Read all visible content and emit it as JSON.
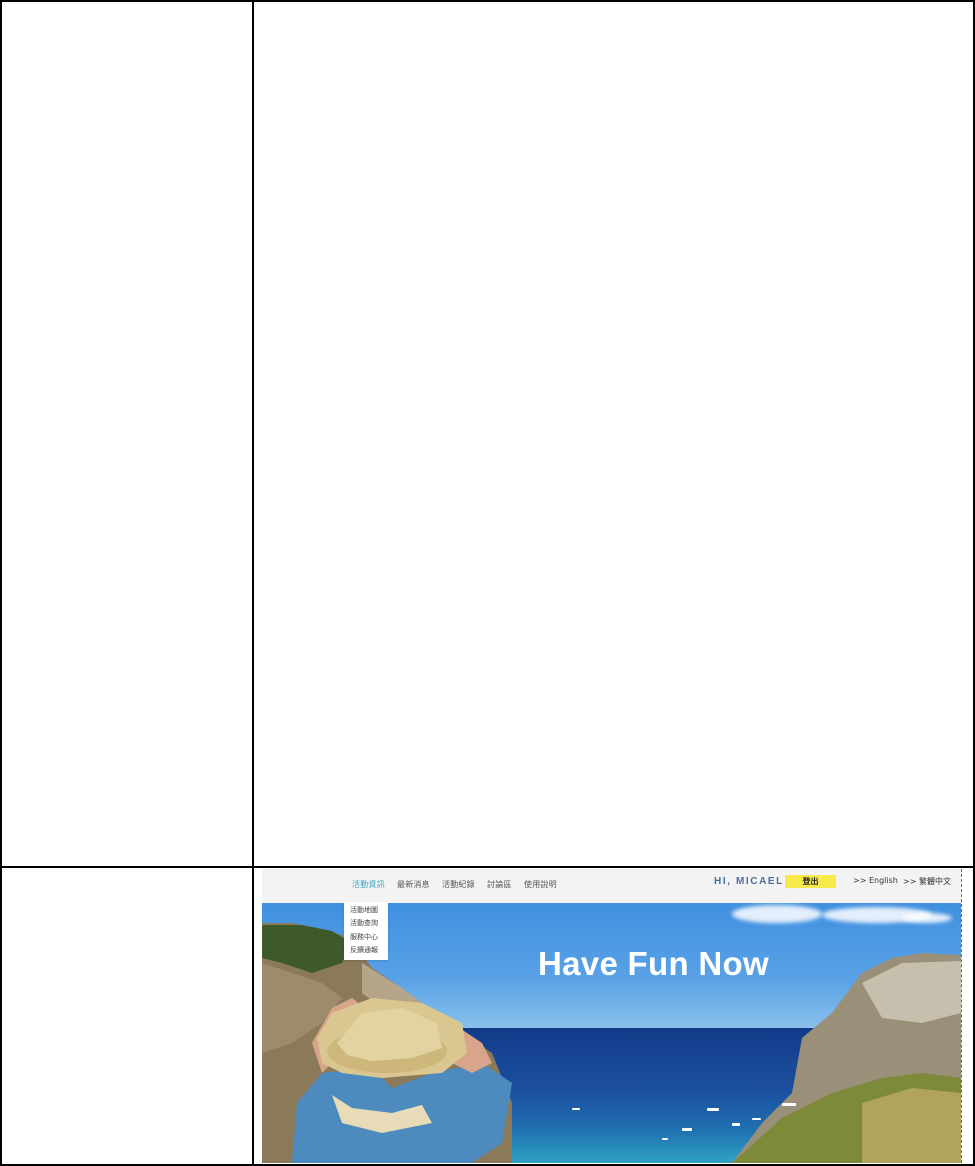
{
  "website": {
    "nav": {
      "items": [
        "活動資訊",
        "最新消息",
        "活動紀錄",
        "討論區",
        "使用說明"
      ],
      "active_index": 0,
      "dropdown": [
        "活動地圖",
        "活動查詢",
        "服務中心",
        "反饋通報"
      ]
    },
    "user": {
      "greeting": "HI, MICAEL",
      "logout_label": "登出"
    },
    "languages": [
      ">> English",
      ">> 繁體中文"
    ],
    "hero": {
      "title": "Have Fun Now"
    }
  },
  "colors": {
    "nav_active": "#3aa6c2",
    "logout_bg": "#f7ea4a",
    "greeting": "#4a6e9c"
  }
}
